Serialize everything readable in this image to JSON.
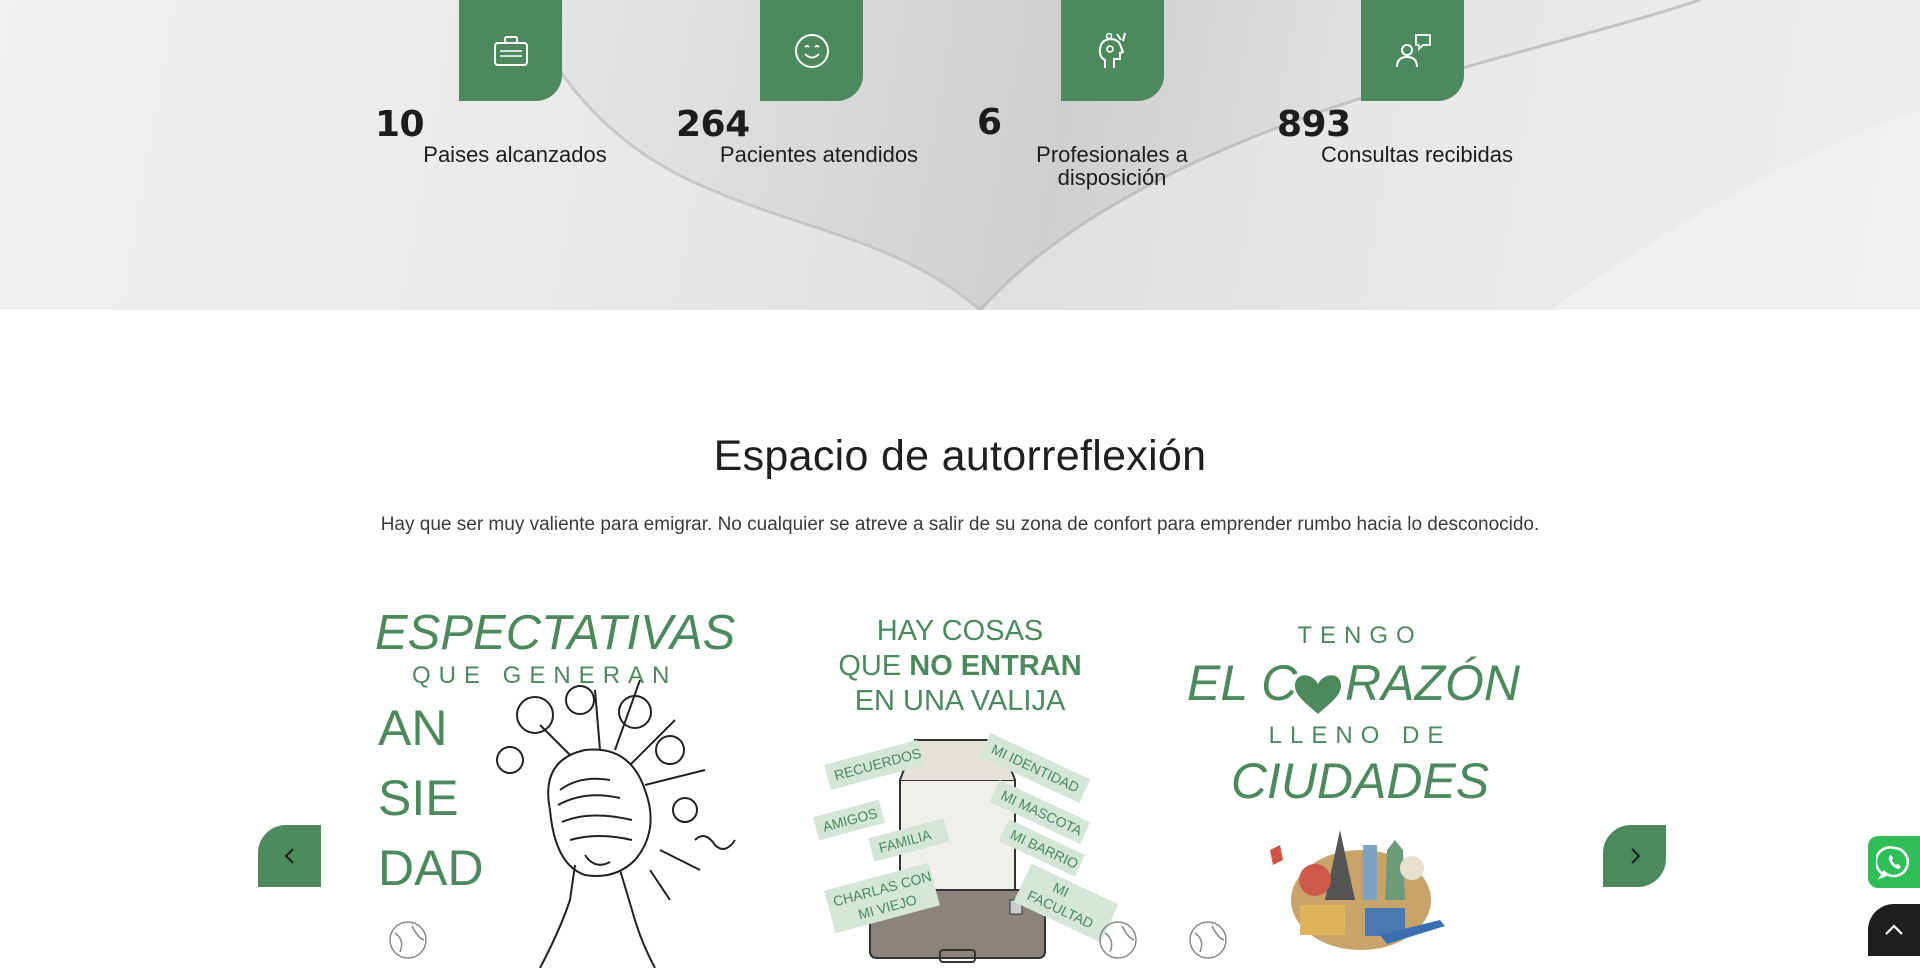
{
  "stats": [
    {
      "number": "10",
      "label": "Paises alcanzados",
      "icon": "briefcase-icon"
    },
    {
      "number": "264",
      "label": "Pacientes atendidos",
      "icon": "smiley-icon"
    },
    {
      "number": "6",
      "label": "Profesionales a disposición",
      "icon": "head-tools-icon"
    },
    {
      "number": "893",
      "label": "Consultas recibidas",
      "icon": "person-chat-icon"
    }
  ],
  "section": {
    "title": "Espacio de autorreflexión",
    "intro": "Hay que ser muy valiente para emigrar. No cualquier se atreve a salir de su zona de confort para emprender rumbo hacia lo desconocido."
  },
  "cards": [
    {
      "line1": "ESPECTATIVAS",
      "line2": "QUE GENERAN",
      "line3": "AN",
      "line4": "SIE",
      "line5": "DAD"
    },
    {
      "line1": "HAY COSAS",
      "line2a": "QUE ",
      "line2b": "NO ENTRAN",
      "line3": "EN UNA VALIJA",
      "tags_left": [
        "RECUERDOS",
        "AMIGOS",
        "FAMILIA",
        "CHARLAS CON",
        "MI VIEJO"
      ],
      "tags_right": [
        "MI IDENTIDAD",
        "MI MASCOTA",
        "MI BARRIO",
        "MI",
        "FACULTAD"
      ]
    },
    {
      "line1": "TENGO",
      "line2a": "EL C",
      "line2b": "RAZÓN",
      "line3": "LLENO DE",
      "line4": "CIUDADES"
    }
  ],
  "controls": {
    "prev_icon": "chevron-left-icon",
    "next_icon": "chevron-right-icon",
    "whatsapp_icon": "whatsapp-icon",
    "top_icon": "chevron-up-icon"
  },
  "colors": {
    "accent": "#4c8a5e",
    "text": "#1f1f1f",
    "whatsapp": "#2fbe57"
  }
}
